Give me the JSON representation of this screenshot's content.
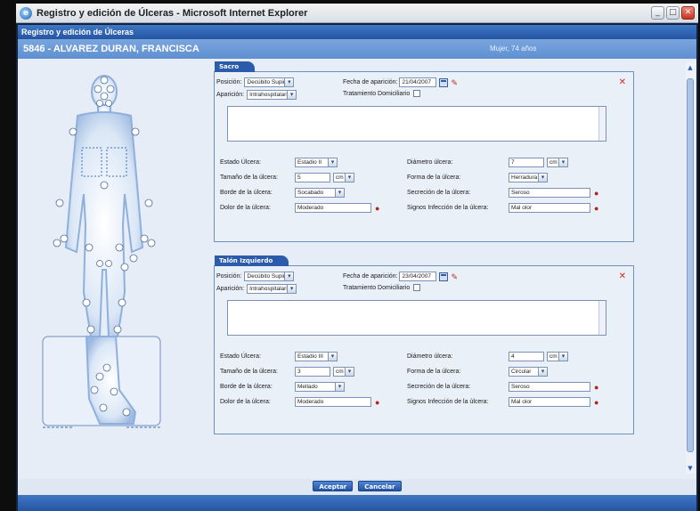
{
  "window": {
    "title": "Registro y edición de Úlceras - Microsoft Internet Explorer",
    "min_btn": "_",
    "max_btn": "□",
    "close_btn": "✕"
  },
  "app": {
    "header": "Registro y edición de Úlceras",
    "patient": "5846 - ALVAREZ DURAN, FRANCISCA",
    "patient_info": "Mujer, 74 años"
  },
  "ulcers": [
    {
      "tab": "Sacro",
      "posicion_label": "Posición:",
      "posicion_value": "Decúbito Supino",
      "fecha_label": "Fecha de aparición:",
      "fecha_value": "21/04/2007",
      "aparicion_label": "Aparición:",
      "aparicion_value": "Intrahospitalaria",
      "tratamiento_label": "Tratamiento Domiciliario",
      "estado_label": "Estado Úlcera:",
      "estado_value": "Estadio II",
      "diametro_label": "Diámetro úlcera:",
      "diametro_value": "7",
      "diametro_unit": "cm",
      "tamano_label": "Tamaño de la úlcera:",
      "tamano_value": "5",
      "tamano_unit": "cm",
      "forma_label": "Forma de la úlcera:",
      "forma_value": "Herradura",
      "borde_label": "Borde de la úlcera:",
      "borde_value": "Socabado",
      "secrecion_label": "Secreción de la úlcera:",
      "secrecion_value": "Seroso",
      "dolor_label": "Dolor de la úlcera:",
      "dolor_value": "Moderado",
      "signos_label": "Signos Infección de la úlcera:",
      "signos_value": "Mal olor"
    },
    {
      "tab": "Talón Izquierdo",
      "posicion_label": "Posición:",
      "posicion_value": "Decúbito Supino",
      "fecha_label": "Fecha de aparición:",
      "fecha_value": "23/04/2007",
      "aparicion_label": "Aparición:",
      "aparicion_value": "Intrahospitalaria",
      "tratamiento_label": "Tratamiento Domiciliario",
      "estado_label": "Estado Úlcera:",
      "estado_value": "Estadio III",
      "diametro_label": "Diámetro úlcera:",
      "diametro_value": "4",
      "diametro_unit": "cm",
      "tamano_label": "Tamaño de la úlcera:",
      "tamano_value": "3",
      "tamano_unit": "cm",
      "forma_label": "Forma de la úlcera:",
      "forma_value": "Circular",
      "borde_label": "Borde de la úlcera:",
      "borde_value": "Mellado",
      "secrecion_label": "Secreción de la úlcera:",
      "secrecion_value": "Seroso",
      "dolor_label": "Dolor de la úlcera:",
      "dolor_value": "Moderado",
      "signos_label": "Signos Infección de la úlcera:",
      "signos_value": "Mal olor"
    }
  ],
  "buttons": {
    "aceptar": "Aceptar",
    "cancelar": "Cancelar"
  },
  "icons": {
    "close_panel": "✕",
    "eraser": "✎",
    "bug": "●"
  },
  "colors": {
    "accent": "#2a5cab",
    "close_red": "#d22a1f"
  }
}
